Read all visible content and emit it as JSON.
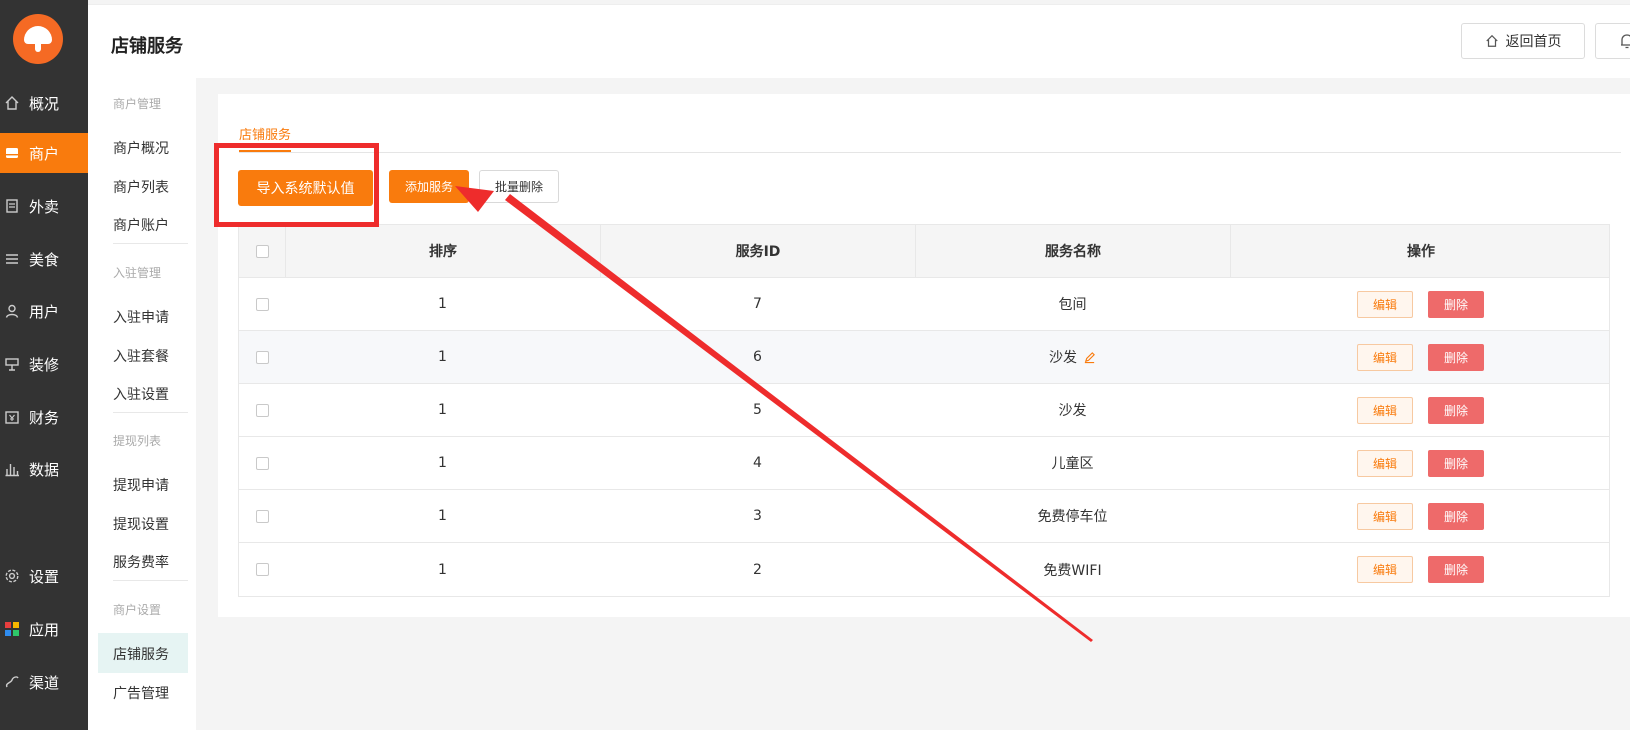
{
  "nav": {
    "items": [
      {
        "label": "概况",
        "icon": "home-icon"
      },
      {
        "label": "商户",
        "icon": "store-icon",
        "active": true
      },
      {
        "label": "外卖",
        "icon": "document-icon"
      },
      {
        "label": "美食",
        "icon": "list-icon"
      },
      {
        "label": "用户",
        "icon": "user-icon"
      },
      {
        "label": "装修",
        "icon": "decorate-icon"
      },
      {
        "label": "财务",
        "icon": "wallet-icon"
      },
      {
        "label": "数据",
        "icon": "chart-icon"
      },
      {
        "label": "设置",
        "icon": "gear-icon"
      },
      {
        "label": "应用",
        "icon": "apps-icon"
      },
      {
        "label": "渠道",
        "icon": "link-icon"
      }
    ]
  },
  "subnav": {
    "groups": [
      "商户管理",
      "入驻管理",
      "提现列表",
      "商户设置"
    ],
    "items": [
      "商户概况",
      "商户列表",
      "商户账户",
      "入驻申请",
      "入驻套餐",
      "入驻设置",
      "提现申请",
      "提现设置",
      "服务费率",
      "店铺服务",
      "广告管理"
    ],
    "active": "店铺服务"
  },
  "header": {
    "title": "店铺服务",
    "home_label": "返回首页"
  },
  "tab": {
    "label": "店铺服务"
  },
  "toolbar": {
    "import_label": "导入系统默认值",
    "add_label": "添加服务",
    "batch_delete_label": "批量删除"
  },
  "table": {
    "headers": {
      "sort": "排序",
      "id": "服务ID",
      "name": "服务名称",
      "op": "操作"
    },
    "rows": [
      {
        "sort": "1",
        "id": "7",
        "name": "包间",
        "edit": "编辑",
        "delete": "删除"
      },
      {
        "sort": "1",
        "id": "6",
        "name": "沙发",
        "edit": "编辑",
        "delete": "删除"
      },
      {
        "sort": "1",
        "id": "5",
        "name": "沙发",
        "edit": "编辑",
        "delete": "删除"
      },
      {
        "sort": "1",
        "id": "4",
        "name": "儿童区",
        "edit": "编辑",
        "delete": "删除"
      },
      {
        "sort": "1",
        "id": "3",
        "name": "免费停车位",
        "edit": "编辑",
        "delete": "删除"
      },
      {
        "sort": "1",
        "id": "2",
        "name": "免费WIFI",
        "edit": "编辑",
        "delete": "删除"
      }
    ]
  },
  "colors": {
    "accent": "#f97b0d",
    "danger": "#ee6a6a",
    "annotation": "#ee2c2c",
    "nav_bg": "#333333"
  }
}
